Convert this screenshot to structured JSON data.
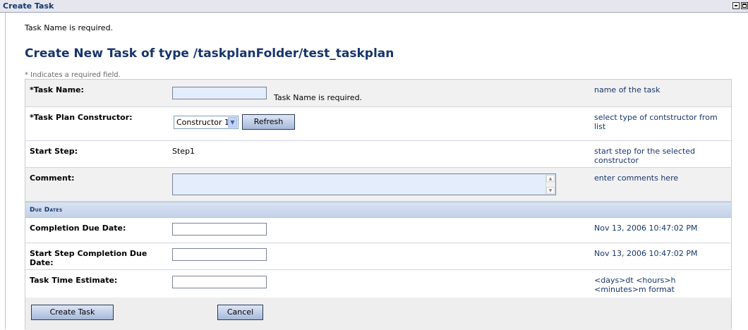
{
  "window": {
    "title": "Create Task"
  },
  "messages": {
    "top_error": "Task Name is required."
  },
  "page": {
    "heading": "Create New Task of type /taskplanFolder/test_taskplan",
    "required_note": "* Indicates a required field."
  },
  "form": {
    "task_name": {
      "label": "*Task Name:",
      "value": "",
      "error": "Task Name is required.",
      "help": "name of the task"
    },
    "constructor": {
      "label": "*Task Plan Constructor:",
      "selected": "Constructor 1",
      "refresh_label": "Refresh",
      "help": "select type of contstructor from list"
    },
    "start_step": {
      "label": "Start Step:",
      "value": "Step1",
      "help": "start step for the selected constructor"
    },
    "comment": {
      "label": "Comment:",
      "value": "",
      "help": "enter comments here"
    },
    "due_dates_header": "Due Dates",
    "completion_due": {
      "label": "Completion Due Date:",
      "value": "",
      "help": "Nov 13, 2006 10:47:02 PM"
    },
    "start_step_due": {
      "label": "Start Step Completion Due Date:",
      "value": "",
      "help": "Nov 13, 2006 10:47:02 PM"
    },
    "time_estimate": {
      "label": "Task Time Estimate:",
      "value": "",
      "help": "<days>dt <hours>h <minutes>m format"
    }
  },
  "buttons": {
    "create": "Create Task",
    "cancel": "Cancel"
  },
  "icons": {
    "minimize": "minimize-icon",
    "maximize": "maximize-icon",
    "dropdown": "chevron-down-icon"
  }
}
